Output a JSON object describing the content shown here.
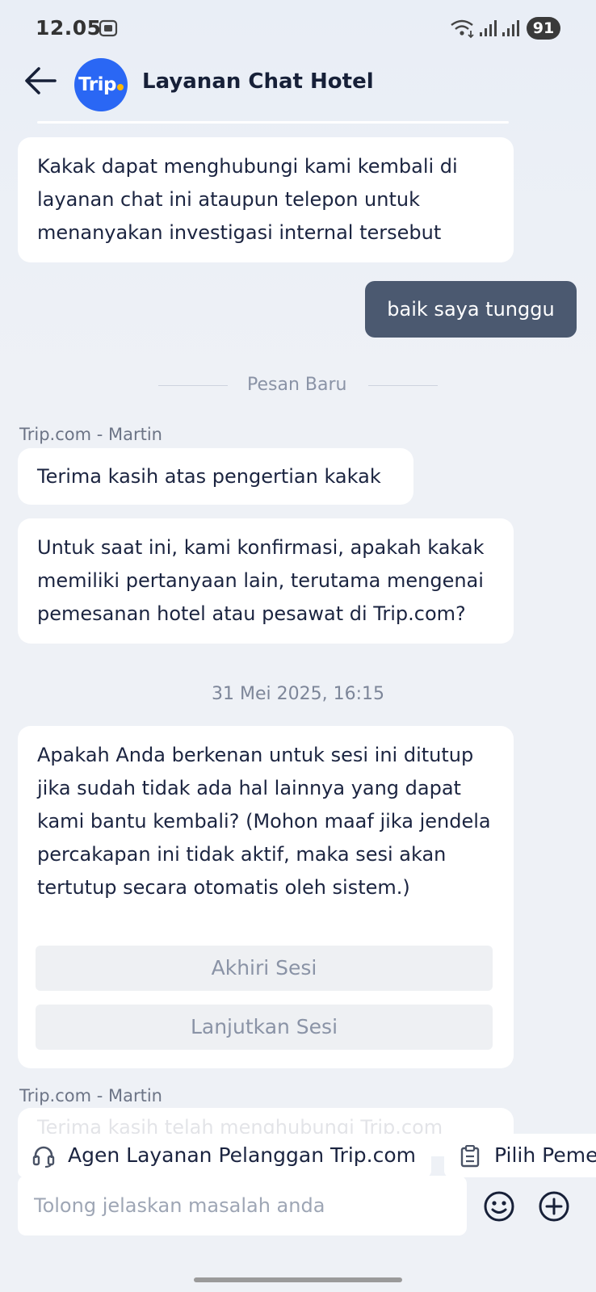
{
  "status_bar": {
    "time": "12.05",
    "battery": "91"
  },
  "header": {
    "logo_text": "Trip",
    "title": "Layanan Chat Hotel"
  },
  "messages": {
    "agent_1": "Kakak dapat menghubungi kami kembali di layanan chat ini ataupun telepon untuk menanyakan investigasi internal tersebut",
    "user_1": "baik saya tunggu",
    "new_separator": "Pesan Baru",
    "sender_1": "Trip.com - Martin",
    "agent_2": "Terima kasih atas pengertian kakak",
    "agent_3": "Untuk saat ini, kami konfirmasi, apakah kakak memiliki pertanyaan lain, terutama mengenai pemesanan hotel atau pesawat di Trip.com?",
    "timestamp_1": "31 Mei 2025, 16:15",
    "agent_4": "Apakah Anda berkenan untuk sesi ini ditutup jika sudah tidak ada hal lainnya yang dapat kami bantu kembali? (Mohon maaf jika jendela percakapan ini tidak aktif, maka sesi akan tertutup secara otomatis oleh sistem.)",
    "end_session_label": "Akhiri Sesi",
    "continue_session_label": "Lanjutkan Sesi",
    "sender_2": "Trip.com - Martin",
    "agent_5_partial": "Terima kasih telah menghubungi Trip.com"
  },
  "quick_actions": [
    {
      "label": "Agen Layanan Pelanggan Trip.com",
      "icon": "headset-icon"
    },
    {
      "label": "Pilih Peme",
      "icon": "clipboard-icon"
    }
  ],
  "composer": {
    "placeholder": "Tolong jelaskan masalah anda"
  },
  "colors": {
    "brand": "#2a67f4",
    "user_bubble": "#4b5970",
    "background": "#eef1f6"
  }
}
